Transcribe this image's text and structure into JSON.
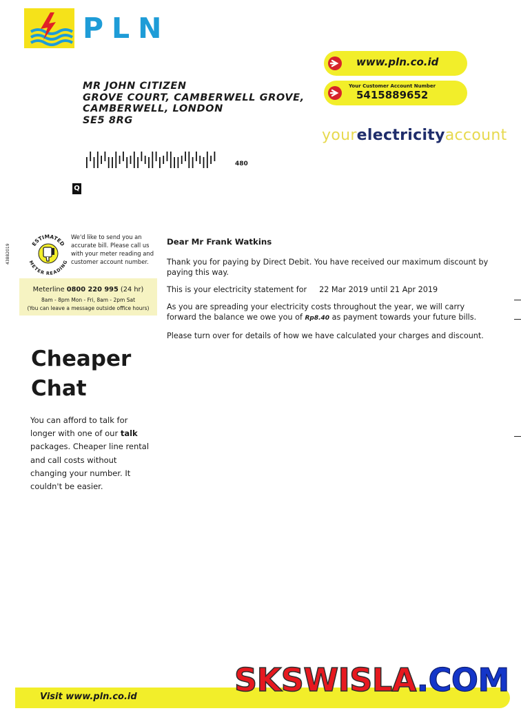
{
  "logo": {
    "text": "PLN"
  },
  "header_links": {
    "website": "www.pln.co.id",
    "account_label": "Your Customer Account Number",
    "account_number": "5415889652"
  },
  "tagline": {
    "part1": "your",
    "part2": "electricity",
    "part3": "account"
  },
  "address": {
    "line1": "MR JOHN CITIZEN",
    "line2": "GROVE COURT, CAMBERWELL GROVE,",
    "line3": "CAMBERWELL, LONDON",
    "line4": "SE5 8RG"
  },
  "barcode_number": "480",
  "box_letter": "Q",
  "side_reference": "43882019",
  "badge": {
    "top_text": "ESTIMATED",
    "bottom_text": "METER READING"
  },
  "meter_note": "We'd like to send you an accurate bill. Please call us with your meter reading and customer account number.",
  "meterline": {
    "label": "Meterline",
    "phone": "0800 220 995",
    "suffix": "(24 hr)",
    "hours": "8am - 8pm Mon - Fri, 8am - 2pm Sat",
    "message": "(You can leave a message outside office hours)"
  },
  "promo": {
    "title_line1": "Cheaper",
    "title_line2": "Chat",
    "body_pre": "You can afford to talk for longer with one of our",
    "body_bold": "talk",
    "body_post": "packages. Cheaper line rental and call costs without changing your number. It couldn't be easier."
  },
  "letter": {
    "greeting": "Dear Mr Frank Watkins",
    "para1": "Thank you for paying by Direct Debit.  You have received our maximum discount by paying this way.",
    "statement_label": "This is your electricity statement for",
    "statement_dates": "22 Mar 2019  until 21 Apr 2019",
    "para3_pre": "As you are spreading your electricity costs throughout the year, we will carry forward the balance we owe you of",
    "para3_amount": "Rp8.40",
    "para3_post": "as payment towards your future bills.",
    "para4": "Please turn over for details of how we have calculated your charges and discount."
  },
  "footer": {
    "text": "Visit  www.pln.co.id"
  },
  "watermark": {
    "part1": "SKSWISLA",
    "part2": ".COM"
  },
  "colors": {
    "yellow": "#f2ee2a",
    "pln_blue": "#1e9cd7",
    "navy": "#1f2d6b",
    "red": "#d6232a"
  }
}
